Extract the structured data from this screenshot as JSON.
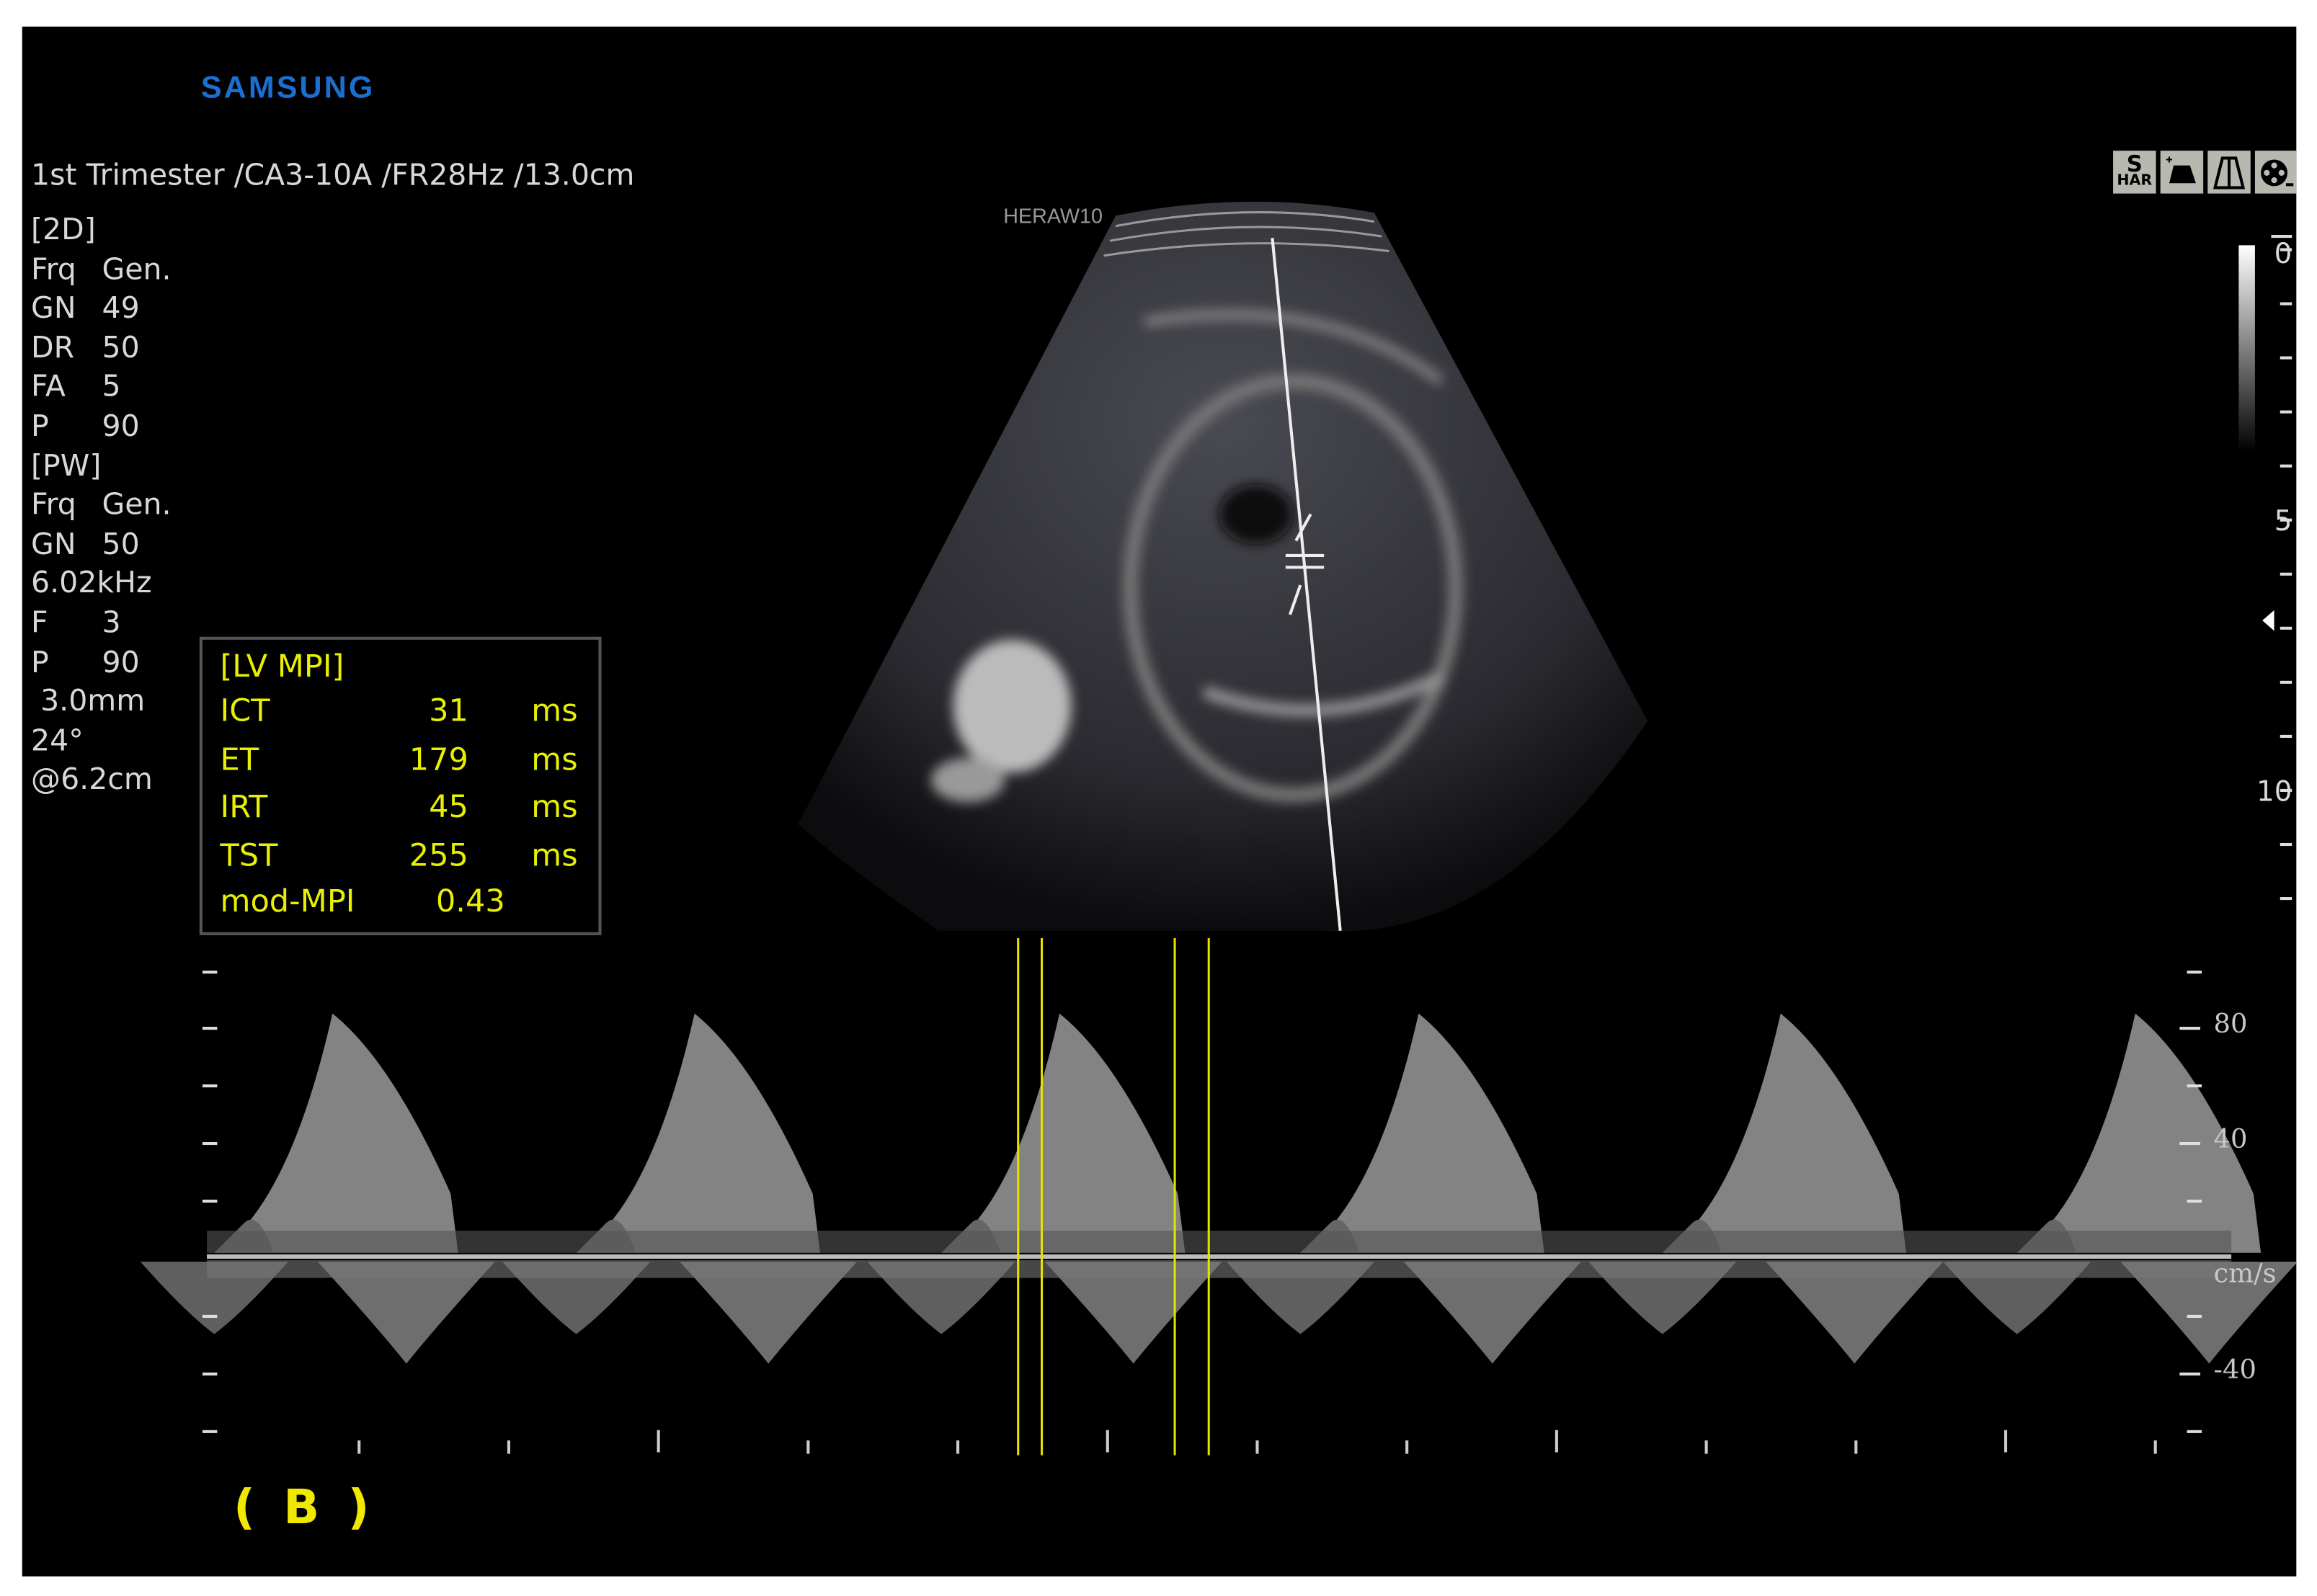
{
  "brand": "SAMSUNG",
  "header": "1st Trimester /CA3-10A /FR28Hz /13.0cm",
  "probe_label": "HERAW10",
  "params_2d": {
    "title": "[2D]",
    "rows": [
      [
        "Frq",
        "Gen."
      ],
      [
        "GN",
        "49"
      ],
      [
        "DR",
        "50"
      ],
      [
        "FA",
        "5"
      ],
      [
        "P",
        "90"
      ]
    ]
  },
  "params_pw": {
    "title": "[PW]",
    "rows": [
      [
        "Frq",
        "Gen."
      ],
      [
        "GN",
        "50"
      ],
      [
        "6.02kHz",
        ""
      ],
      [
        "F",
        "3"
      ],
      [
        "P",
        "90"
      ],
      [
        " 3.0mm",
        ""
      ],
      [
        "24°",
        ""
      ],
      [
        "@6.2cm",
        ""
      ]
    ]
  },
  "mpi": {
    "title": "[LV MPI]",
    "rows": [
      {
        "label": "ICT",
        "value": "31",
        "unit": "ms"
      },
      {
        "label": "ET",
        "value": "179",
        "unit": "ms"
      },
      {
        "label": "IRT",
        "value": "45",
        "unit": "ms"
      },
      {
        "label": "TST",
        "value": "255",
        "unit": "ms"
      }
    ],
    "index_label": "mod-MPI",
    "index_value": "0.43"
  },
  "mode_icons": [
    "S HAR",
    "2D-zoom-icon",
    "trapezoid-icon",
    "film-reel-icon"
  ],
  "depth_scale": [
    "0",
    "5",
    "10"
  ],
  "velocity_scale": {
    "labels": [
      "80",
      "40",
      "-40"
    ],
    "unit": "cm/s"
  },
  "panel_tag": "( B )",
  "colors": {
    "accent": "#f0e800",
    "brand": "#1a6fd0"
  }
}
